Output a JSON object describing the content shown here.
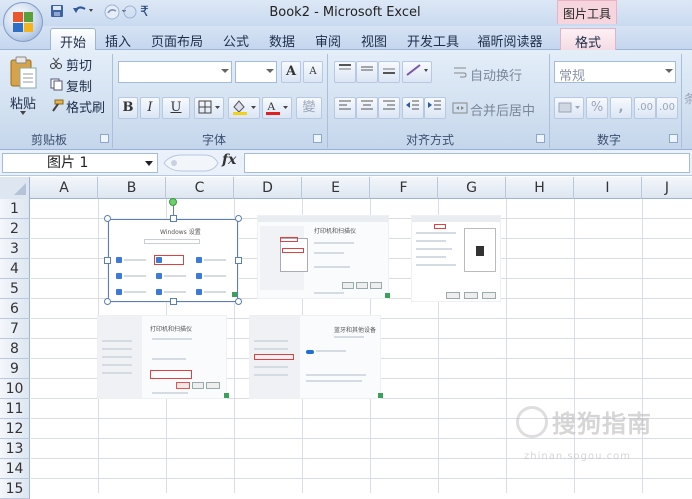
{
  "title": "Book2 - Microsoft Excel",
  "contextual_tab_group": "图片工具",
  "tabs": [
    "开始",
    "插入",
    "页面布局",
    "公式",
    "数据",
    "审阅",
    "视图",
    "开发工具",
    "福昕阅读器",
    "格式"
  ],
  "ribbon": {
    "clipboard": {
      "paste": "粘贴",
      "cut": "剪切",
      "copy": "复制",
      "format_painter": "格式刷",
      "label": "剪贴板"
    },
    "font": {
      "label": "字体",
      "bold": "B",
      "italic": "I",
      "underline": "U",
      "grow": "A",
      "shrink": "A",
      "wen": "變"
    },
    "alignment": {
      "wrap_text": "自动换行",
      "merge_center": "合并后居中",
      "label": "对齐方式"
    },
    "number": {
      "format": "常规",
      "label": "数字",
      "percent": "%",
      "comma": ",",
      "inc_decimal": ".00",
      "dec_decimal": ".00",
      "extra": "条"
    }
  },
  "formula_bar": {
    "name_box": "图片 1",
    "fx": "fx",
    "value": ""
  },
  "columns": [
    "A",
    "B",
    "C",
    "D",
    "E",
    "F",
    "G",
    "H",
    "I",
    "J"
  ],
  "rows": [
    "1",
    "2",
    "3",
    "4",
    "5",
    "6",
    "7",
    "8",
    "9",
    "10",
    "11",
    "12",
    "13",
    "14",
    "15"
  ],
  "pictures": {
    "p1": {
      "title": "Windows 设置"
    },
    "p2": {
      "title": "打印机和扫描仪"
    },
    "p4": {
      "title": "打印机和扫描仪"
    },
    "p5": {
      "title": "蓝牙和其他设备"
    }
  },
  "watermark": {
    "text": "搜狗指南",
    "url": "zhinan.sogou.com"
  },
  "colors": {
    "accent": "#3a7bd5",
    "selection": "#5a7fb8",
    "ribbon": "#cfdeef"
  }
}
